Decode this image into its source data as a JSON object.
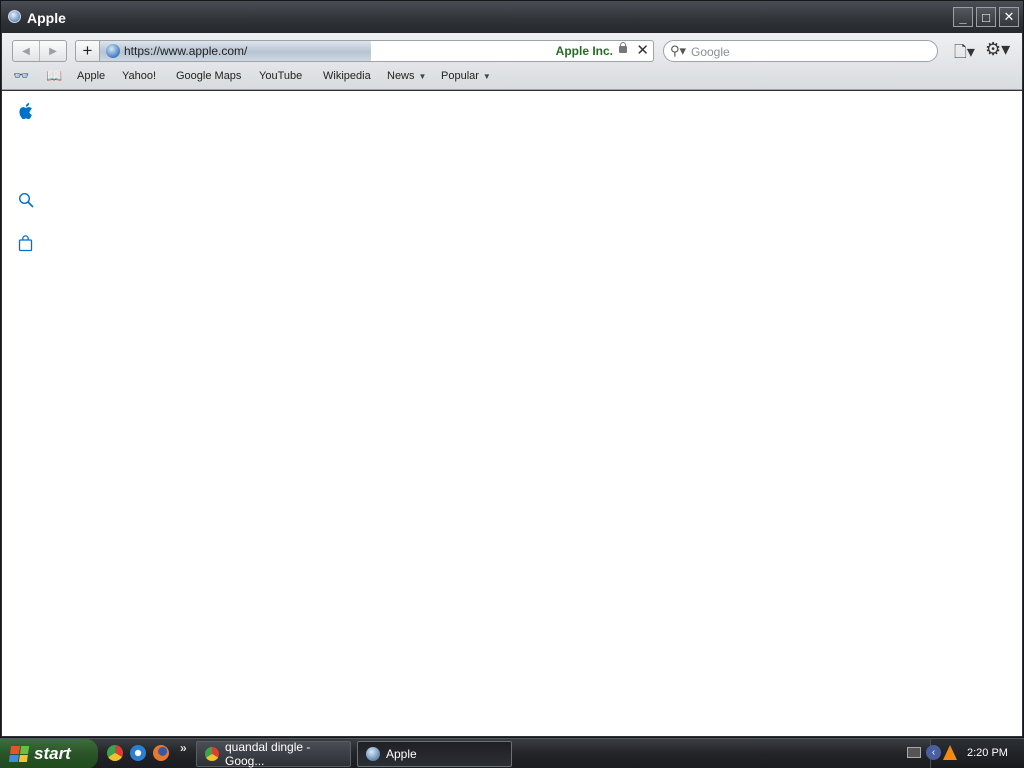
{
  "window": {
    "title": "Apple"
  },
  "toolbar": {
    "back_icon": "back-arrow-icon",
    "forward_icon": "forward-arrow-icon",
    "add_label": "+",
    "url": "https://www.apple.com/",
    "site_identity": "Apple Inc.",
    "search_placeholder": "Google",
    "load_progress_percent": 49
  },
  "bookmarks": {
    "items": [
      {
        "label": "Apple"
      },
      {
        "label": "Yahoo!"
      },
      {
        "label": "Google Maps"
      },
      {
        "label": "YouTube"
      },
      {
        "label": "Wikipedia"
      },
      {
        "label": "News",
        "dropdown": true
      },
      {
        "label": "Popular",
        "dropdown": true
      }
    ]
  },
  "page": {
    "icons": [
      "apple-logo-icon",
      "search-icon",
      "shopping-bag-icon"
    ],
    "accent_color": "#0070c9"
  },
  "taskbar": {
    "start_label": "start",
    "tasks": [
      {
        "label": "quandal dingle - Goog...",
        "active": false
      },
      {
        "label": "Apple",
        "active": true
      }
    ],
    "clock": "2:20 PM"
  }
}
